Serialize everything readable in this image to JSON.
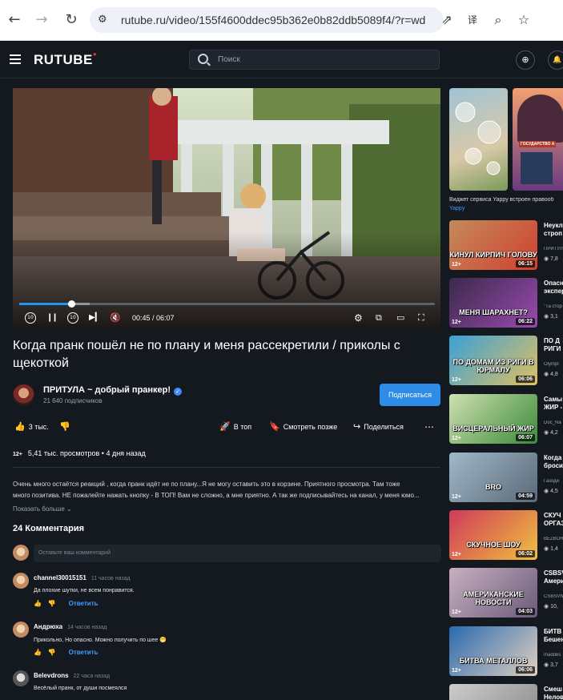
{
  "browser": {
    "back_icon": "←",
    "forward_icon": "→",
    "reload_icon": "↻",
    "url": "rutube.ru/video/155f4600ddec95b362e0b82ddb5089f4/?r=wd",
    "open_icon": "⇗",
    "translate_icon": "译",
    "zoom_icon": "⌕",
    "star_icon": "☆"
  },
  "header": {
    "logo": "RUTUBE",
    "logo_mark": "●",
    "search_placeholder": "Поиск",
    "upload_icon": "⊕",
    "notify_icon": "🔔"
  },
  "player": {
    "time": "00:45 / 06:07",
    "progress": 0.125,
    "buffered": 0.17,
    "rewind_label": "10",
    "forward_label": "10",
    "pause_icon": "❙❙",
    "next_icon": "▶▎",
    "mute_icon": "🔇",
    "settings_icon": "⚙",
    "pip_icon": "⧉",
    "theater_icon": "▭",
    "fullscreen_icon": "⛶"
  },
  "video": {
    "title": "Когда пранк пошёл не по плану и меня рассекретили / приколы с щекоткой",
    "channel": "ПРИТУЛА ~ добрый пранкер!",
    "verified_icon": "✓",
    "subscribers": "21 640 подписчиков",
    "subscribe_label": "Подписаться",
    "likes": "3 тыс.",
    "like_icon": "👍",
    "dislike_icon": "👎",
    "top_label": "В топ",
    "top_icon": "🚀",
    "later_label": "Смотреть позже",
    "later_icon": "🔖",
    "share_label": "Поделиться",
    "share_icon": "↪",
    "more_icon": "⋯",
    "age": "12+",
    "views": "5,41 тыс. просмотров",
    "posted": "4 дня назад",
    "description_line1": "Очень много остаётся реакций , когда пранк идёт не по плану...Я не могу оставить это в корзине. Приятного просмотра. Там тоже",
    "description_line2": "много позитива. НЕ пожалейте нажать кнопку - В ТОП! Вам не сложно, а мне приятно. А так же подписывайтесь на канал, у меня юмо...",
    "show_more": "Показать больше",
    "show_more_icon": "⌄"
  },
  "comments": {
    "heading": "24 Комментария",
    "input_placeholder": "Оставьте ваш комментарий",
    "reply_label": "Ответить",
    "items": [
      {
        "user": "channel30015151",
        "time": "11 часов назад",
        "text": "Да плохие шутки, не всем понравится."
      },
      {
        "user": "Андрюха",
        "time": "14 часов назад",
        "text": "Прикольно, Но опасно. Можно получить по шее 😁"
      },
      {
        "user": "Belevdrons",
        "time": "22 часа назад",
        "text": "Весёлый пранк, от души посмеялся"
      }
    ]
  },
  "sidebar": {
    "ad_text": "Виджет сервиса Yappy встроен правооб",
    "ad_source": "Yappy",
    "ad_image2_caption": "ГОСУДАРСТВО А",
    "recs": [
      {
        "caption": "КИНУЛ КИРПИЧ ГОЛОВУ",
        "age": "12+",
        "duration": "06:15",
        "title1": "Неукл",
        "title2": "строп",
        "channel": "ПРИТУЛ",
        "views": "7,8"
      },
      {
        "caption": "МЕНЯ ШАРАХНЕТ?",
        "age": "12+",
        "duration": "06:22",
        "title1": "Опасн",
        "title2": "экспер",
        "channel": "\"Та стор",
        "views": "3,1"
      },
      {
        "caption": "ПО ДОМАМ ИЗ РИГИ В ЮРМАЛУ",
        "age": "12+",
        "duration": "06:06",
        "title1": "ПО Д",
        "title2": "РИГИ",
        "channel": "Olympl",
        "views": "4,8"
      },
      {
        "caption": "ВИСЦЕРАЛЬНЫЙ ЖИР",
        "age": "12+",
        "duration": "06:07",
        "title1": "Самы",
        "title2": "ЖИР -",
        "channel": "Doc_Na",
        "views": "4,2"
      },
      {
        "caption": "BRO",
        "age": "12+",
        "duration": "04:59",
        "title1": "Когда",
        "title2": "броси",
        "channel": "Газоди",
        "views": "4,5"
      },
      {
        "caption": "СКУЧНОЕ ШОУ",
        "age": "12+",
        "duration": "06:02",
        "title1": "СКУЧ",
        "title2": "ОРГАЗ",
        "channel": "BEZBOR",
        "views": "1,4"
      },
      {
        "caption": "АМЕРИКАНСКИЕ НОВОСТИ",
        "age": "12+",
        "duration": "04:03",
        "title1": "CSBSV",
        "title2": "Амери",
        "channel": "CSBSVN",
        "views": "10,"
      },
      {
        "caption": "БИТВА МЕТАЛЛОВ",
        "age": "12+",
        "duration": "06:06",
        "title1": "БИТВ",
        "title2": "Бешен",
        "channel": "maddes",
        "views": "3,7"
      },
      {
        "caption": "",
        "age": "",
        "duration": "",
        "title1": "Смеш",
        "title2": "Нелов",
        "channel": "",
        "views": ""
      }
    ]
  }
}
